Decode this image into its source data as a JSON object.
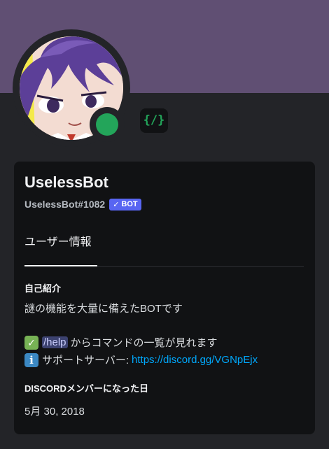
{
  "profile": {
    "display_name": "UselessBot",
    "username": "UselessBot#1082",
    "bot_badge": "BOT",
    "bot_check": "✓",
    "status": "online",
    "app_badge_text": "{/}"
  },
  "tabs": [
    {
      "label": "ユーザー情報",
      "selected": true
    }
  ],
  "about": {
    "title": "自己紹介",
    "line1": "謎の機能を大量に備えたBOTです",
    "check_emoji": "✓",
    "command": "/help",
    "line2_text": "からコマンドの一覧が見れます",
    "info_emoji": "i",
    "line3_text": "サポートサーバー:",
    "link": "https://discord.gg/VGNpEjx"
  },
  "member_since": {
    "title": "DISCORDメンバーになった日",
    "date": "5月 30, 2018"
  },
  "colors": {
    "banner": "#604f73",
    "status_online": "#23a55a",
    "bot_badge": "#5865f2",
    "link": "#00a8fc"
  }
}
